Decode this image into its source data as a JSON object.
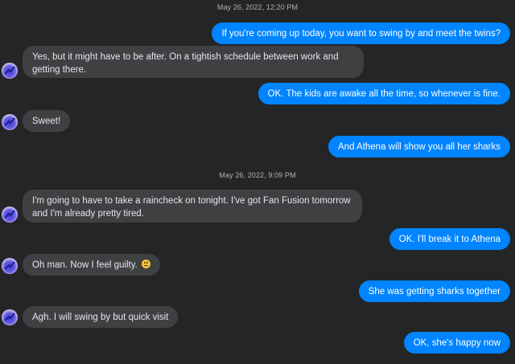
{
  "timestamps": [
    "May 26, 2022, 12:20 PM",
    "May 26, 2022, 9:09 PM"
  ],
  "messages": [
    {
      "from": "me",
      "text": "If you're coming up today, you want to swing by and meet the twins?"
    },
    {
      "from": "them",
      "text": "Yes, but it might have to be after.  On a tightish schedule between work and getting there."
    },
    {
      "from": "me",
      "text": "OK. The kids are awake all the time, so whenever is fine."
    },
    {
      "from": "them",
      "text": "Sweet!"
    },
    {
      "from": "me",
      "text": "And Athena will show you all her sharks"
    },
    {
      "from": "them",
      "text": "I'm going to have to take a raincheck on tonight.  I've got Fan Fusion tomorrow and I'm already pretty tired."
    },
    {
      "from": "me",
      "text": "OK. I'll break it to Athena"
    },
    {
      "from": "them",
      "text": "Oh man. Now I feel guilty.",
      "emoji": "slightly-frowning-face-icon"
    },
    {
      "from": "me",
      "text": "She was getting sharks together"
    },
    {
      "from": "them",
      "text": "Agh.  I will swing by but quick visit"
    },
    {
      "from": "me",
      "text": "OK, she's happy now"
    }
  ],
  "colors": {
    "background": "#242526",
    "outgoing_bubble": "#0084ff",
    "incoming_bubble": "#3e4042",
    "timestamp_text": "#b0b3b8"
  },
  "icons": {
    "avatar": "avatar-icon"
  }
}
